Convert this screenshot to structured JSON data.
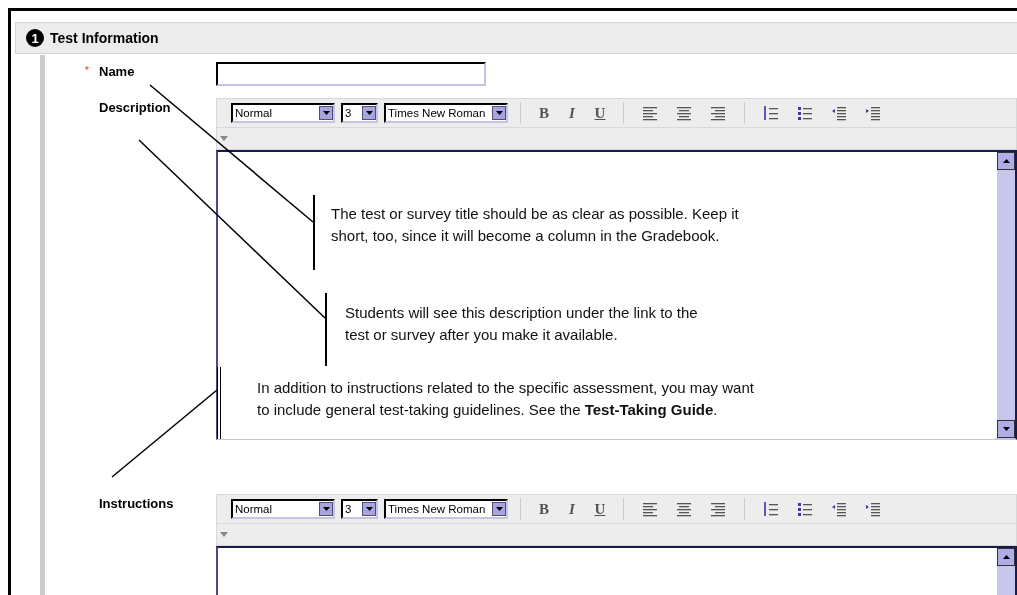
{
  "section": {
    "number": "1",
    "title": "Test Information"
  },
  "required_mark": "*",
  "fields": [
    {
      "kind": "text",
      "label": "Name",
      "required": true
    },
    {
      "kind": "editor",
      "label": "Description",
      "required": false,
      "toolbar": {
        "format": "Normal",
        "size": "3",
        "font": "Times New Roman",
        "styles": [
          {
            "kind": "bold",
            "label": "B"
          },
          {
            "kind": "italic",
            "label": "I"
          },
          {
            "kind": "underline",
            "label": "U"
          }
        ]
      }
    },
    {
      "kind": "editor",
      "label": "Instructions",
      "required": false,
      "toolbar": {
        "format": "Normal",
        "size": "3",
        "font": "Times New Roman",
        "styles": [
          {
            "kind": "bold",
            "label": "B"
          },
          {
            "kind": "italic",
            "label": "I"
          },
          {
            "kind": "underline",
            "label": "U"
          }
        ]
      }
    }
  ],
  "callouts": [
    {
      "text": "The test or survey title should be as clear as possible. Keep it\nshort, too, since it will become a column in the Gradebook."
    },
    {
      "text": "Students will see this description under the link to the\ntest or survey after you make it available."
    },
    {
      "text": "In addition to instructions related to the specific assessment, you may want\nto include general test-taking guidelines. See the **Test-Taking Guide**."
    }
  ]
}
